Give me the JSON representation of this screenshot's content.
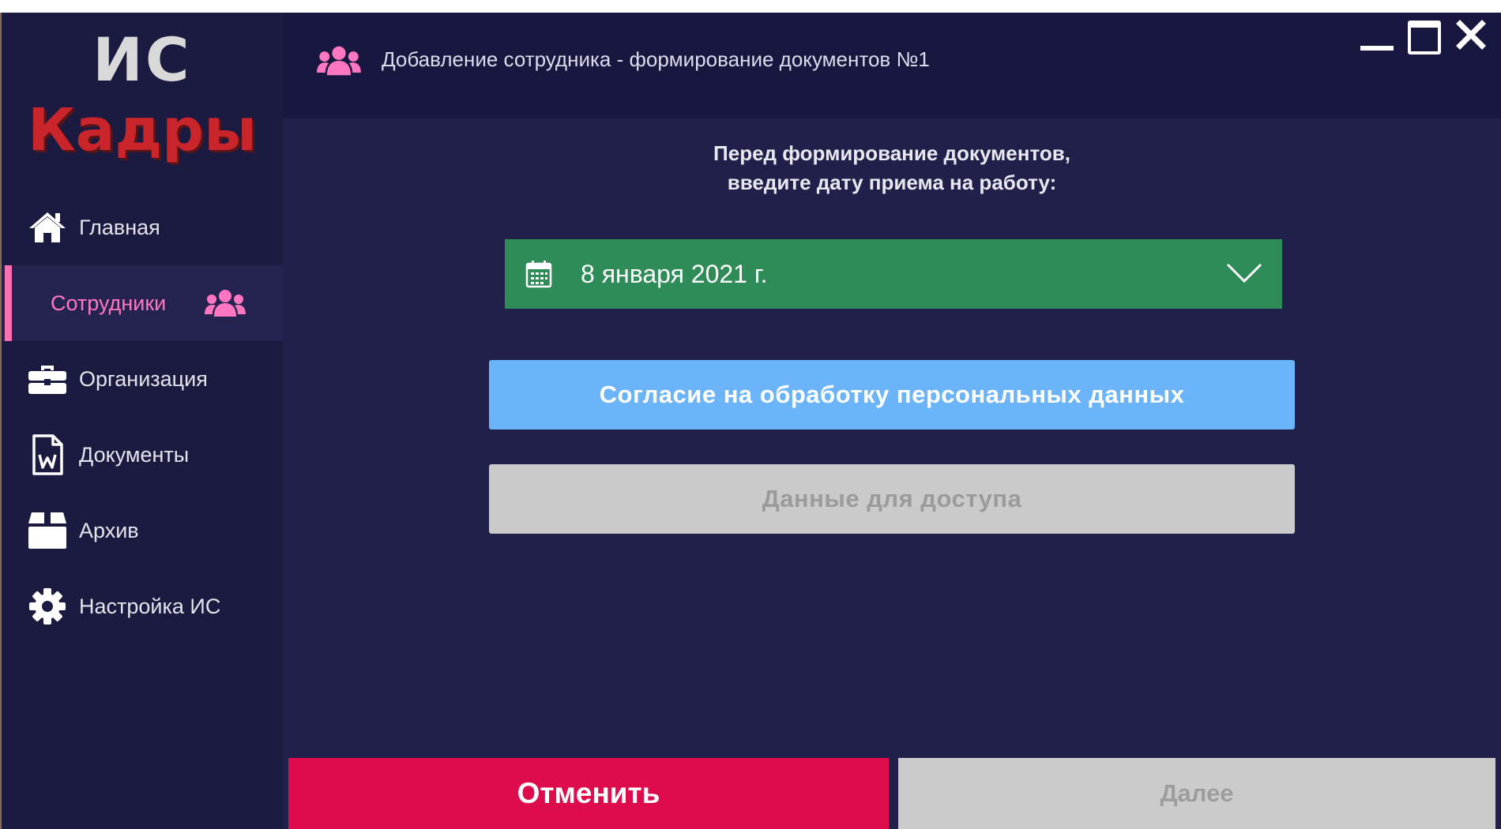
{
  "logo": {
    "line1": "ИС",
    "line2": "Кадры"
  },
  "sidebar": {
    "items": [
      {
        "label": "Главная",
        "icon": "home-icon"
      },
      {
        "label": "Сотрудники",
        "icon": "users-icon",
        "active": true
      },
      {
        "label": "Организация",
        "icon": "briefcase-icon"
      },
      {
        "label": "Документы",
        "icon": "word-document-icon"
      },
      {
        "label": "Архив",
        "icon": "archive-box-icon"
      },
      {
        "label": "Настройка ИС",
        "icon": "gear-icon"
      }
    ]
  },
  "header": {
    "title": "Добавление сотрудника - формирование документов №1",
    "icon": "users-icon"
  },
  "main": {
    "prompt_line1": "Перед формирование документов,",
    "prompt_line2": "введите дату приема на работу:",
    "date_value": "8 января 2021 г.",
    "consent_button": "Согласие на обработку персональных данных",
    "access_button": "Данные для доступа"
  },
  "footer": {
    "cancel_label": "Отменить",
    "next_label": "Далее"
  },
  "colors": {
    "background": "#21204a",
    "sidebar": "#1b1a40",
    "accent_pink": "#ff6fb4",
    "logo_red": "#c9252a",
    "date_green": "#2f8b57",
    "primary_blue": "#6cb4f9",
    "cancel_red": "#de0b4d",
    "disabled_gray": "#cacaca"
  }
}
